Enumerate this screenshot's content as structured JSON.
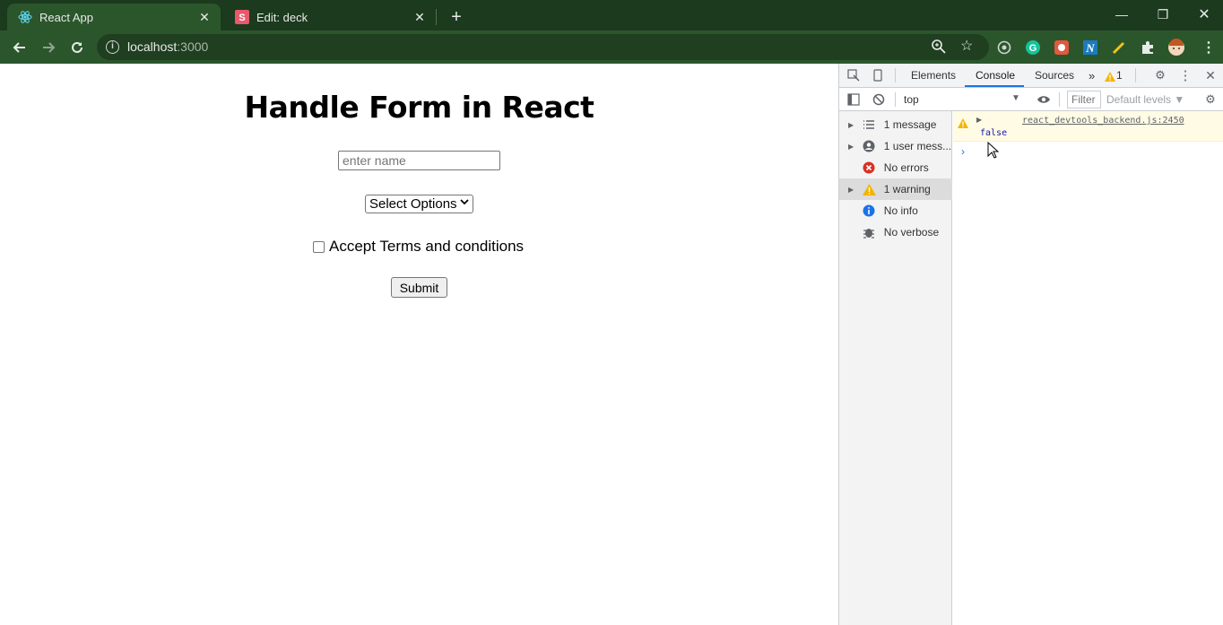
{
  "browser": {
    "tabs": [
      {
        "title": "React App",
        "active": true
      },
      {
        "title": "Edit: deck",
        "active": false
      }
    ],
    "url_host": "localhost",
    "url_port": ":3000"
  },
  "page": {
    "title": "Handle Form in React",
    "name_placeholder": "enter name",
    "select_value": "Select Options",
    "terms_label": "Accept Terms and conditions",
    "submit_label": "Submit"
  },
  "devtools": {
    "tabs": [
      "Elements",
      "Console",
      "Sources"
    ],
    "active_tab": "Console",
    "warning_count": "1",
    "context": "top",
    "filter_placeholder": "Filter",
    "levels": "Default levels ▼",
    "sidebar": [
      {
        "label": "1 message",
        "icon": "list-icon"
      },
      {
        "label": "1 user mess...",
        "icon": "user-icon"
      },
      {
        "label": "No errors",
        "icon": "error-icon"
      },
      {
        "label": "1 warning",
        "icon": "warning-icon"
      },
      {
        "label": "No info",
        "icon": "info-icon"
      },
      {
        "label": "No verbose",
        "icon": "bug-icon"
      }
    ],
    "console_source": "react_devtools_backend.js:2450",
    "console_value": "false",
    "prompt": "›"
  },
  "colors": {
    "chrome_dark": "#1c3a1e",
    "chrome_toolbar": "#2b562c",
    "devtools_accent": "#1a73e8",
    "warning_bg": "#fffbe5"
  }
}
